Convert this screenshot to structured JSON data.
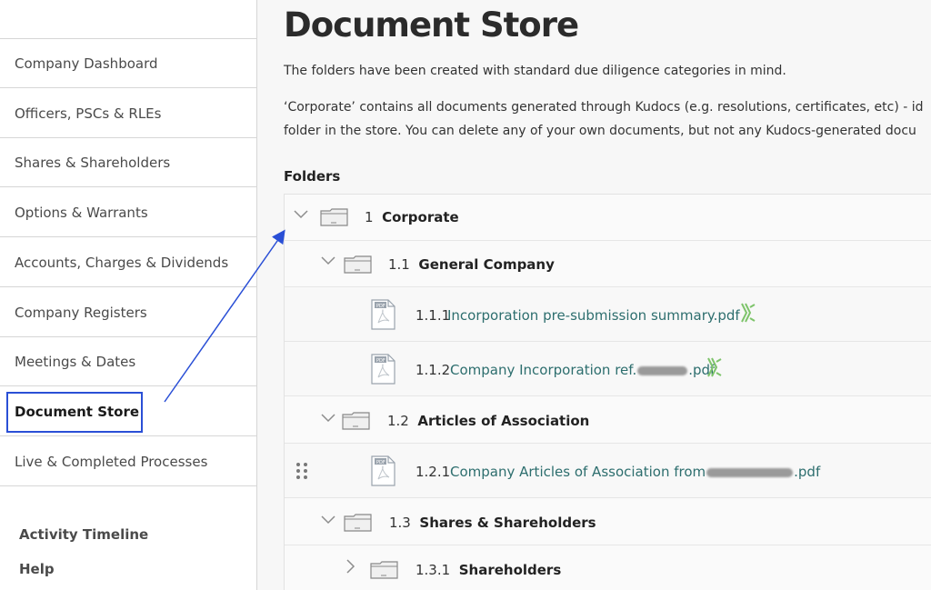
{
  "sidebar": {
    "items": [
      {
        "label": "Company Dashboard"
      },
      {
        "label": "Officers, PSCs & RLEs"
      },
      {
        "label": "Shares & Shareholders"
      },
      {
        "label": "Options & Warrants"
      },
      {
        "label": "Accounts, Charges & Dividends"
      },
      {
        "label": "Company Registers"
      },
      {
        "label": "Meetings & Dates"
      },
      {
        "label": "Document Store",
        "active": true
      },
      {
        "label": "Live & Completed Processes"
      }
    ],
    "footer": {
      "activity": "Activity Timeline",
      "help": "Help"
    }
  },
  "main": {
    "title": "Document Store",
    "intro1": "The folders have been created with standard due diligence categories in mind.",
    "intro2": "‘Corporate’ contains all documents generated through Kudocs (e.g. resolutions, certificates, etc) - id",
    "intro3": "folder in the store. You can delete any of your own documents, but not any Kudocs-generated docu",
    "folders_heading": "Folders"
  },
  "tree": {
    "corporate": {
      "number": "1",
      "name": "Corporate"
    },
    "general_company": {
      "number": "1.1",
      "name": "General Company"
    },
    "file_111": {
      "number": "1.1.1",
      "name": "Incorporation pre-submission summary.pdf"
    },
    "file_112": {
      "number": "1.1.2",
      "name_prefix": "Company Incorporation ref.",
      "name_suffix": ".pdf"
    },
    "articles": {
      "number": "1.2",
      "name": "Articles of Association"
    },
    "file_121": {
      "number": "1.2.1",
      "name_prefix": "Company Articles of Association from",
      "name_suffix": ".pdf"
    },
    "shares": {
      "number": "1.3",
      "name": "Shares & Shareholders"
    },
    "shareholders": {
      "number": "1.3.1",
      "name": "Shareholders"
    }
  },
  "icons": {
    "folder": "folder-icon",
    "pdf": "pdf-file-icon",
    "kudocs": "kudocs-logo-icon",
    "expanded": "chevron-down-icon",
    "collapsed": "chevron-right-icon",
    "drag": "drag-handle-icon"
  },
  "colors": {
    "accent_link": "#2d6e6e",
    "highlight_box": "#2a4fd6",
    "kudocs_green": "#7ec46b"
  }
}
